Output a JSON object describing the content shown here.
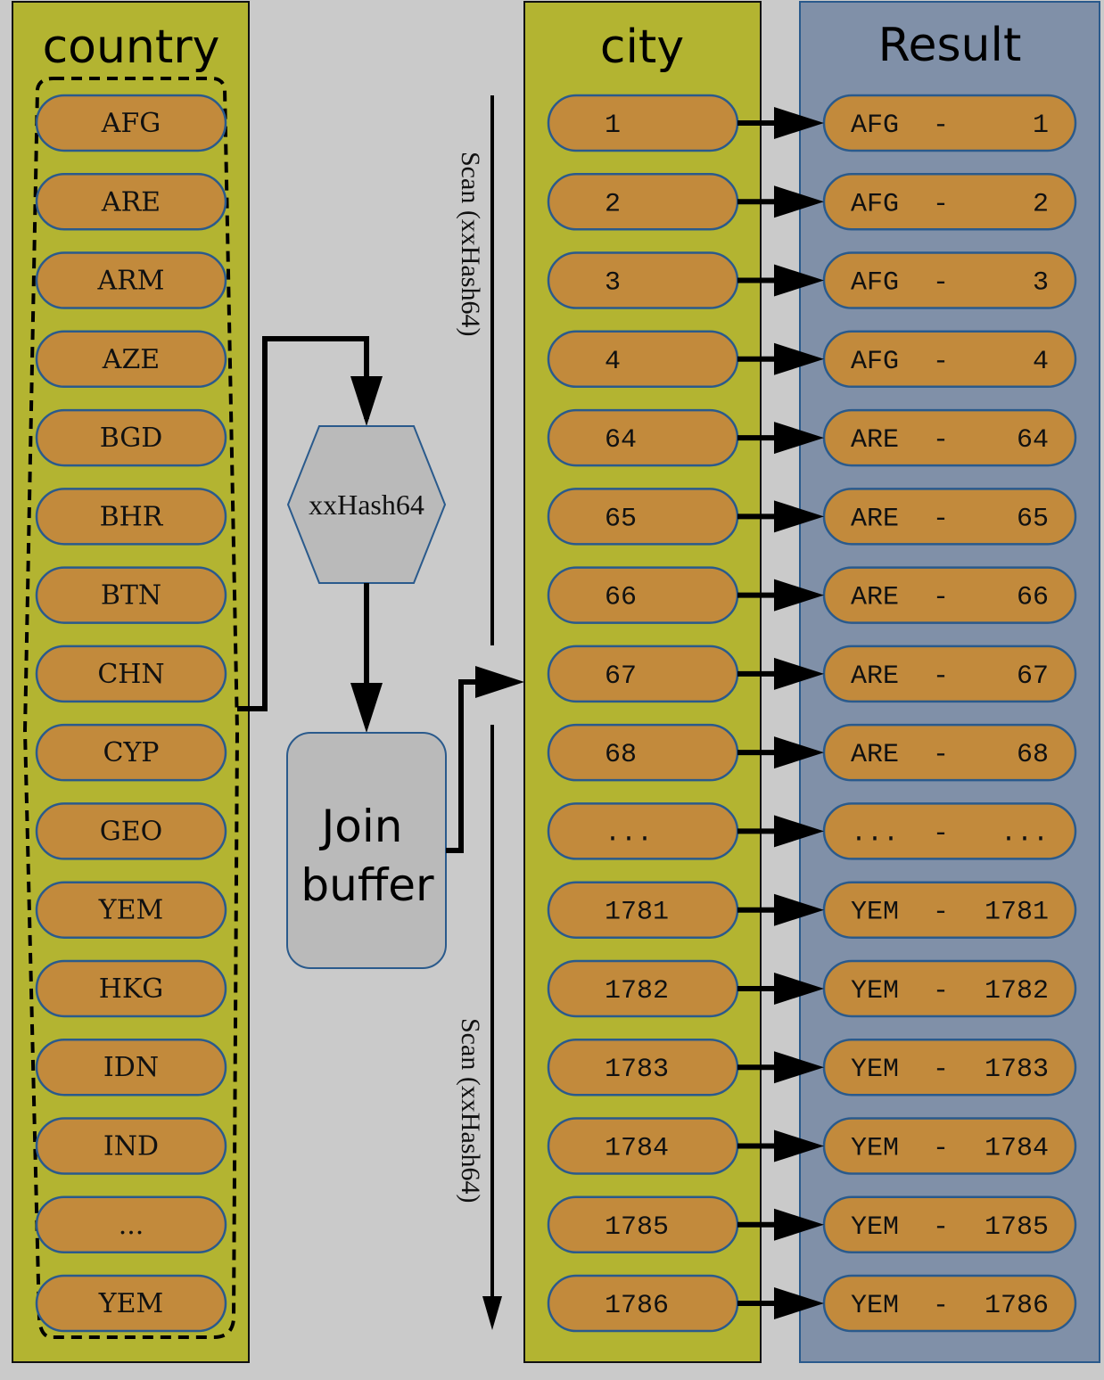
{
  "colors": {
    "background": "#cacaca",
    "table_fill": "#b3b431",
    "result_fill": "#8090a8",
    "pill_fill": "#c28a3c",
    "pill_stroke": "#2a5a8c",
    "node_fill": "#bababa",
    "node_stroke": "#2a5a8c"
  },
  "country": {
    "title": "country",
    "rows": [
      "AFG",
      "ARE",
      "ARM",
      "AZE",
      "BGD",
      "BHR",
      "BTN",
      "CHN",
      "CYP",
      "GEO",
      "YEM",
      "HKG",
      "IDN",
      "IND",
      "...",
      "YEM"
    ]
  },
  "hash_node": {
    "label": "xxHash64"
  },
  "join_buffer": {
    "line1": "Join",
    "line2": "buffer"
  },
  "scan_labels": {
    "top": "Scan (xxHash64)",
    "bottom": "Scan (xxHash64)"
  },
  "city": {
    "title": "city",
    "rows": [
      "1",
      "2",
      "3",
      "4",
      "64",
      "65",
      "66",
      "67",
      "68",
      "...",
      "1781",
      "1782",
      "1783",
      "1784",
      "1785",
      "1786"
    ]
  },
  "result": {
    "title": "Result",
    "rows": [
      {
        "left": "AFG",
        "sep": "-",
        "right": "1"
      },
      {
        "left": "AFG",
        "sep": "-",
        "right": "2"
      },
      {
        "left": "AFG",
        "sep": "-",
        "right": "3"
      },
      {
        "left": "AFG",
        "sep": "-",
        "right": "4"
      },
      {
        "left": "ARE",
        "sep": "-",
        "right": "64"
      },
      {
        "left": "ARE",
        "sep": "-",
        "right": "65"
      },
      {
        "left": "ARE",
        "sep": "-",
        "right": "66"
      },
      {
        "left": "ARE",
        "sep": "-",
        "right": "67"
      },
      {
        "left": "ARE",
        "sep": "-",
        "right": "68"
      },
      {
        "left": "...",
        "sep": "-",
        "right": "..."
      },
      {
        "left": "YEM",
        "sep": "-",
        "right": "1781"
      },
      {
        "left": "YEM",
        "sep": "-",
        "right": "1782"
      },
      {
        "left": "YEM",
        "sep": "-",
        "right": "1783"
      },
      {
        "left": "YEM",
        "sep": "-",
        "right": "1784"
      },
      {
        "left": "YEM",
        "sep": "-",
        "right": "1785"
      },
      {
        "left": "YEM",
        "sep": "-",
        "right": "1786"
      }
    ]
  }
}
